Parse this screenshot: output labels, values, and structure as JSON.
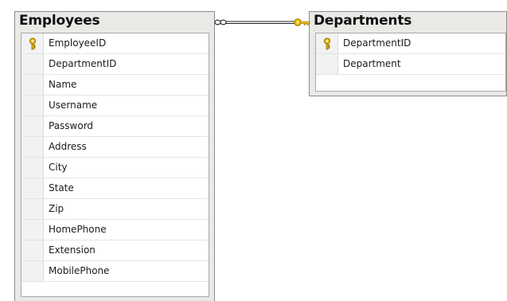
{
  "employees_table": {
    "title": "Employees",
    "columns": [
      {
        "name": "EmployeeID",
        "primary_key": true
      },
      {
        "name": "DepartmentID",
        "primary_key": false
      },
      {
        "name": "Name",
        "primary_key": false
      },
      {
        "name": "Username",
        "primary_key": false
      },
      {
        "name": "Password",
        "primary_key": false
      },
      {
        "name": "Address",
        "primary_key": false
      },
      {
        "name": "City",
        "primary_key": false
      },
      {
        "name": "State",
        "primary_key": false
      },
      {
        "name": "Zip",
        "primary_key": false
      },
      {
        "name": "HomePhone",
        "primary_key": false
      },
      {
        "name": "Extension",
        "primary_key": false
      },
      {
        "name": "MobilePhone",
        "primary_key": false
      }
    ]
  },
  "departments_table": {
    "title": "Departments",
    "columns": [
      {
        "name": "DepartmentID",
        "primary_key": true
      },
      {
        "name": "Department",
        "primary_key": false
      }
    ]
  },
  "relationship": {
    "from_end": "many-infinity-icon",
    "to_end": "key-icon"
  },
  "icons": {
    "primary_key": "key-icon"
  },
  "colors": {
    "key_gold": "#d8a400",
    "table_frame": "#e9e9e6",
    "line": "#222222"
  }
}
